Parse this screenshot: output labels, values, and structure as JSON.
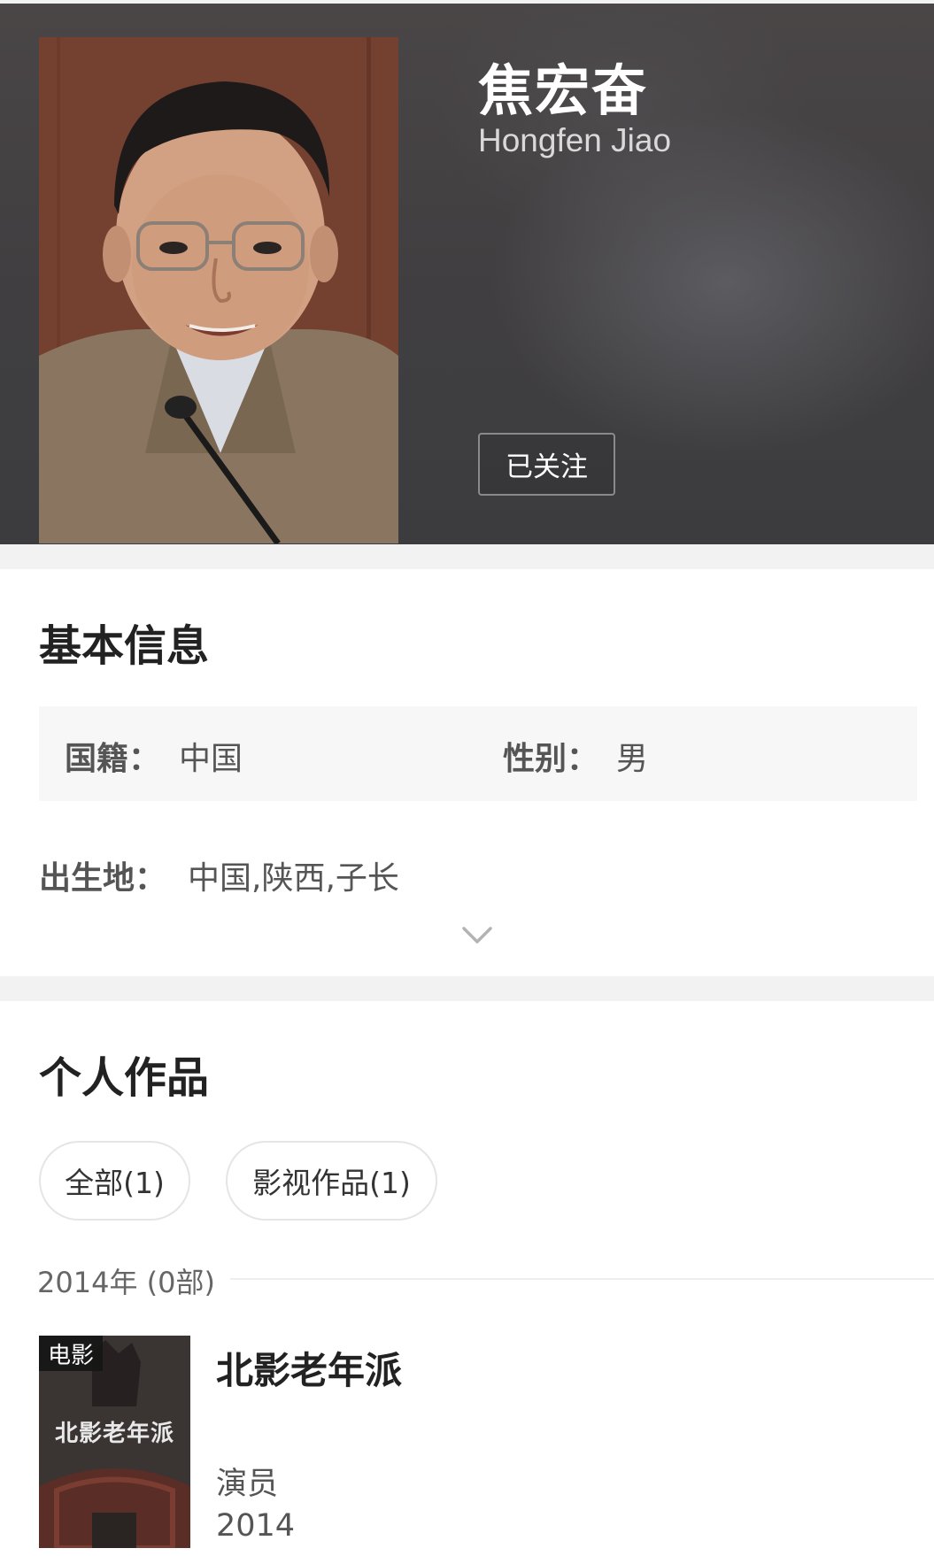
{
  "profile": {
    "name_cn": "焦宏奋",
    "name_en": "Hongfen Jiao",
    "follow_label": "已关注"
  },
  "basic_info": {
    "title": "基本信息",
    "nationality_label": "国籍：",
    "nationality_value": "中国",
    "gender_label": "性别：",
    "gender_value": "男",
    "birthplace_label": "出生地：",
    "birthplace_value": "中国,陕西,子长",
    "expand_icon": "chevron-down-icon"
  },
  "works": {
    "title": "个人作品",
    "tabs": [
      {
        "label": "全部(1)"
      },
      {
        "label": "影视作品(1)"
      }
    ],
    "year_group": "2014年 (0部)",
    "items": [
      {
        "badge": "电影",
        "poster_text": "北影老年派",
        "title": "北影老年派",
        "role": "演员",
        "year": "2014"
      }
    ]
  },
  "colors": {
    "header_bg": "#403e40",
    "page_bg": "#ffffff",
    "separator": "#f2f2f2",
    "info_box_bg": "#f7f7f7"
  }
}
